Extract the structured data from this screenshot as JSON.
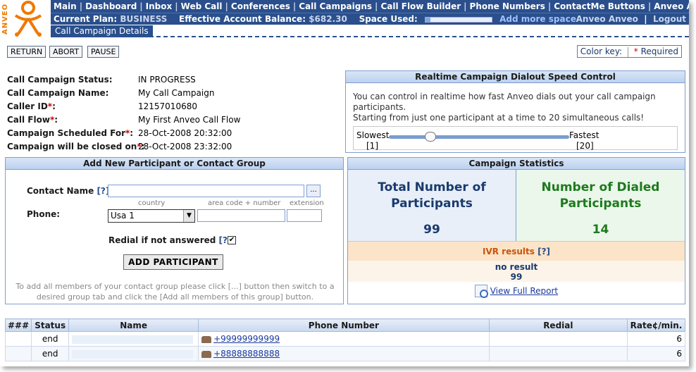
{
  "brand": {
    "logo_text": "ANVEO",
    "logo_color": "#f07800"
  },
  "nav": {
    "items": [
      "Main",
      "Dashboard",
      "Inbox",
      "Web Call",
      "Conferences",
      "Call Campaigns",
      "Call Flow Builder",
      "Phone Numbers",
      "ContactMe Buttons",
      "Anveo API"
    ]
  },
  "subnav": {
    "plan_label": "Current Plan:",
    "plan_value": "BUSINESS",
    "balance_label": "Effective Account Balance:",
    "balance_value": "$682.30",
    "space_label": "Space Used:",
    "space_used_fraction": 0.08,
    "add_space_link": "Add more space",
    "user_name": "Anveo Anveo",
    "logout": "Logout"
  },
  "page_tab": "Call Campaign Details",
  "actions": {
    "return": "RETURN",
    "abort": "ABORT",
    "pause": "PAUSE"
  },
  "color_key": {
    "label": "Color key:",
    "required_star": "*",
    "required_text": "Required"
  },
  "status": {
    "rows": [
      {
        "key": "Call Campaign Status:",
        "required": false,
        "value": "IN PROGRESS"
      },
      {
        "key": "Call Campaign Name:",
        "required": false,
        "value": "My Call Campaign"
      },
      {
        "key": "Caller ID",
        "required": true,
        "value": "12157010680"
      },
      {
        "key": "Call Flow",
        "required": true,
        "value": "My First Anveo Call Flow"
      },
      {
        "key": "Campaign Scheduled For",
        "required": true,
        "value": "28-Oct-2008 20:32:00"
      },
      {
        "key": "Campaign will be closed on",
        "required": true,
        "value": "28-Oct-2008 23:32:00"
      }
    ]
  },
  "speed_panel": {
    "title": "Realtime Campaign Dialout Speed Control",
    "text_line1": "You can control in realtime how fast Anveo dials out your call campaign participants.",
    "text_line2": "Starting from just one participant at a time to 20 simultaneous calls!",
    "slowest": "Slowest",
    "fastest": "Fastest",
    "min_label": "[1]",
    "max_label": "[20]",
    "current_value": 5
  },
  "add_panel": {
    "title": "Add New Participant or Contact Group",
    "contact_label": "Contact Name",
    "contact_help": "[?]",
    "browse": "...",
    "phone_label": "Phone:",
    "country_caption": "country",
    "area_caption": "area code + number",
    "ext_caption": "extension",
    "country_value": "Usa 1",
    "redial_label": "Redial if not answered",
    "redial_help": "[?]",
    "redial_checked": "✔",
    "add_button": "ADD PARTICIPANT",
    "hint_line1": "To add all members of your contact group please click [...] button then switch to a",
    "hint_line2": "desired group tab and click the [Add all members of this group] button."
  },
  "stats_panel": {
    "title": "Campaign Statistics",
    "total_label_1": "Total Number of",
    "total_label_2": "Participants",
    "total_value": "99",
    "dialed_label_1": "Number of Dialed",
    "dialed_label_2": "Participants",
    "dialed_value": "14",
    "ivr_label": "IVR results",
    "ivr_help": "[?]",
    "ivr_result_label": "no result",
    "ivr_result_value": "99",
    "report_link": "View Full Report"
  },
  "table": {
    "headers": [
      "###",
      "Status",
      "Name",
      "Phone Number",
      "Redial",
      "Rate¢/min."
    ],
    "rows": [
      {
        "num": "",
        "status": "end",
        "name": "",
        "phone": "+99999999999",
        "redial": "",
        "rate": "6"
      },
      {
        "num": "",
        "status": "end",
        "name": "",
        "phone": "+88888888888",
        "redial": "",
        "rate": "6"
      }
    ]
  }
}
